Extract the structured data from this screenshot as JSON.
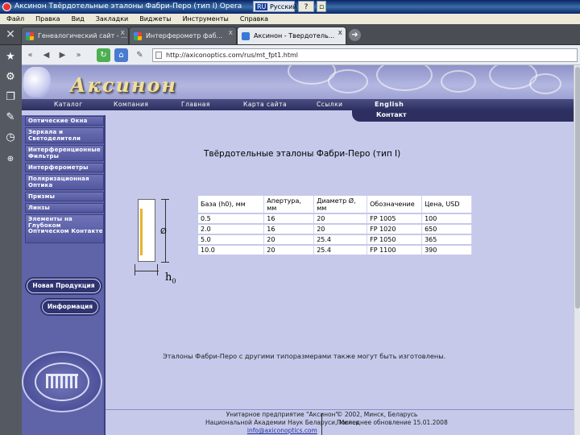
{
  "window": {
    "title": "Аксинон   Твёрдотельные эталоны Фабри-Перо (тип I)   Opera",
    "lang_prefix": "RU",
    "lang": "Русский",
    "help": "?"
  },
  "menu": [
    "Файл",
    "Правка",
    "Вид",
    "Закладки",
    "Виджеты",
    "Инструменты",
    "Справка"
  ],
  "tabs": [
    {
      "label": "Генеалогический сайт - ...",
      "active": false
    },
    {
      "label": "Интерферометр фаб...",
      "active": false
    },
    {
      "label": "Аксинон - Твердотель...",
      "active": true
    }
  ],
  "address": {
    "url": "http://axiconoptics.com/rus/mt_fpt1.html"
  },
  "site": {
    "logo": "Аксинон",
    "top_nav": [
      "Каталог",
      "Компания",
      "Главная",
      "Карта сайта",
      "Ссылки",
      "English"
    ],
    "contact": "Контакт",
    "sidebar": [
      "Оптические Окна",
      "Зеркала и Светоделители",
      "Интерференционные Фильтры",
      "Интерферометры",
      "Поляризационная Оптика",
      "Призмы",
      "Линзы",
      "Элементы на Глубоком Оптическом Контакте"
    ],
    "new_products": "Новая Продукция",
    "information": "Информация",
    "emblem_text": "НАЦИОНАЛЬНАЯ АКАДЕМИЯ НАУК"
  },
  "content": {
    "title": "Твёрдотельные эталоны Фабри-Перо (тип I)",
    "diagram": {
      "diameter_symbol": "Ø",
      "h_label": "h",
      "h_sub": "0"
    },
    "table": {
      "headers": [
        "База (h0), мм",
        "Апертура, мм",
        "Диаметр Ø, мм",
        "Обозначение",
        "Цена, USD"
      ],
      "rows": [
        [
          "0.5",
          "16",
          "20",
          "FP 1005",
          "100"
        ],
        [
          "2.0",
          "16",
          "20",
          "FP 1020",
          "650"
        ],
        [
          "5.0",
          "20",
          "25.4",
          "FP 1050",
          "365"
        ],
        [
          "10.0",
          "20",
          "25.4",
          "FP 1100",
          "390"
        ]
      ]
    },
    "note": "Эталоны Фабри-Перо с другими типоразмерами также могут быть изготовлены."
  },
  "footer": {
    "left_line1": "Унитарное предприятие \"Аксинон\"",
    "left_line2": "Национальной Академии Наук Беларуси, Минск",
    "email": "info@axiconoptics.com",
    "right_line1": "© 2002, Минск, Беларусь",
    "right_line2": "Последнее обновление 15.01.2008"
  }
}
